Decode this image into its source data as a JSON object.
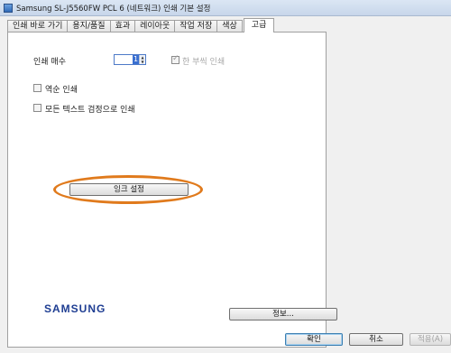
{
  "window": {
    "title": "Samsung SL-J5560FW PCL 6 (네트워크) 인쇄 기본 설정"
  },
  "tabs": [
    {
      "label": "인쇄 바로 가기"
    },
    {
      "label": "용지/품질"
    },
    {
      "label": "효과"
    },
    {
      "label": "레이아웃"
    },
    {
      "label": "작업 저장"
    },
    {
      "label": "색상"
    },
    {
      "label": "고급"
    }
  ],
  "advanced": {
    "copies_label": "인쇄 매수",
    "copies_value": "1",
    "collate_label": "한 부씩 인쇄",
    "collate_checked": true,
    "collate_enabled": false,
    "reverse_label": "역순 인쇄",
    "reverse_checked": false,
    "all_text_black_label": "모든 텍스트 검정으로 인쇄",
    "all_text_black_checked": false,
    "ink_settings_label": "잉크 설정"
  },
  "brand": {
    "logo_text": "SAMSUNG",
    "logo_color": "#1e3d92"
  },
  "info_button_label": "정보...",
  "footer": {
    "ok_label": "확인",
    "cancel_label": "취소",
    "apply_label": "적용(A)"
  },
  "colors": {
    "highlight_ellipse": "#e07a1c"
  }
}
